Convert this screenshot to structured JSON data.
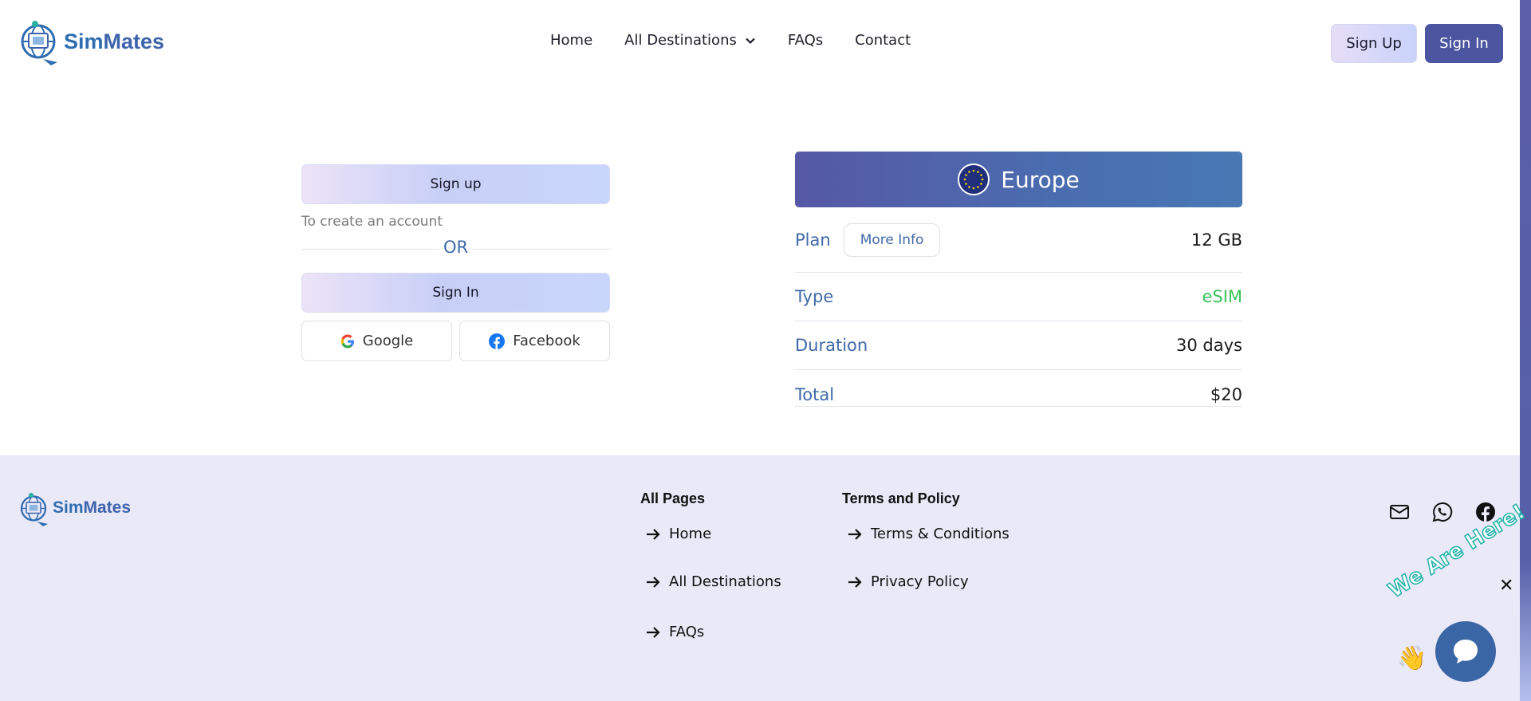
{
  "brand": {
    "name_part1": "Sim",
    "name_part2": "Mates"
  },
  "nav": {
    "items": [
      {
        "label": "Home"
      },
      {
        "label": "All Destinations"
      },
      {
        "label": "FAQs"
      },
      {
        "label": "Contact"
      }
    ],
    "sign_up_label": "Sign Up",
    "sign_in_label": "Sign In"
  },
  "auth": {
    "sign_up_label": "Sign up",
    "sign_up_subtitle": "To create an account",
    "or_label": "OR",
    "sign_in_label": "Sign In",
    "google_label": "Google",
    "facebook_label": "Facebook"
  },
  "plan": {
    "region": "Europe",
    "rows": {
      "plan_key": "Plan",
      "more_info_label": "More Info",
      "plan_value": "12 GB",
      "type_key": "Type",
      "type_value": "eSIM",
      "duration_key": "Duration",
      "duration_value": "30 days",
      "total_key": "Total",
      "total_value": "$20"
    }
  },
  "footer": {
    "all_pages_title": "All Pages",
    "all_pages_links": [
      "Home",
      "All Destinations",
      "FAQs"
    ],
    "terms_title": "Terms and Policy",
    "terms_links": [
      "Terms & Conditions",
      "Privacy Policy"
    ]
  },
  "chat": {
    "tagline": "We Are Here!"
  },
  "colors": {
    "brand_blue": "#4c56a0",
    "accent_blue": "#3f6aa8",
    "esim_green": "#3bc45a",
    "footer_bg": "#e9e9f8"
  },
  "icons": [
    "chevron-down-icon",
    "google-icon",
    "facebook-icon",
    "eu-flag-icon",
    "arrow-right-icon",
    "mail-icon",
    "whatsapp-icon",
    "chat-icon",
    "close-icon",
    "wave-hand-icon"
  ]
}
